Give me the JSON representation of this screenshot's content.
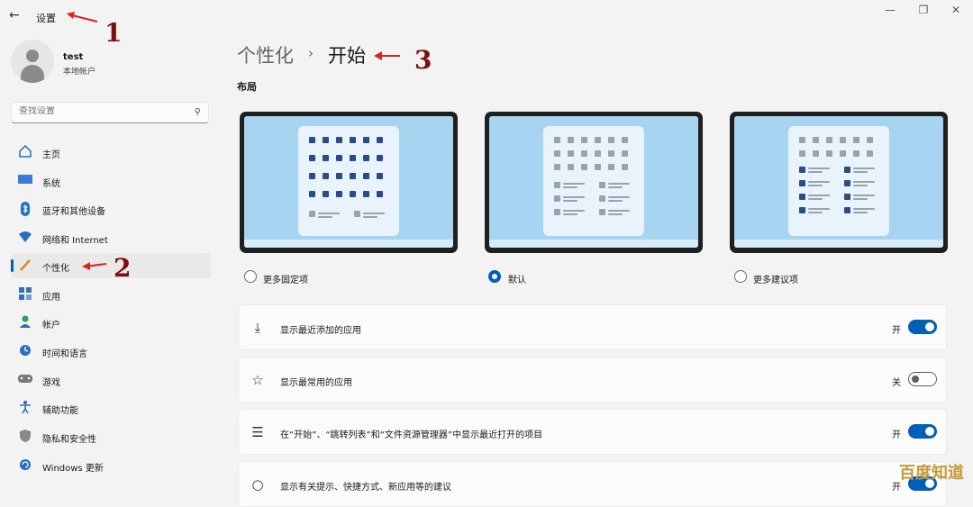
{
  "window": {
    "title": "设置",
    "back_icon": "back-arrow-icon",
    "controls": [
      "minimize-icon",
      "maximize-icon",
      "close-icon"
    ]
  },
  "user": {
    "name": "test",
    "account_type": "本地帐户"
  },
  "search": {
    "placeholder": "查找设置"
  },
  "sidebar": {
    "items": [
      {
        "label": "主页",
        "icon": "home-icon"
      },
      {
        "label": "系统",
        "icon": "system-icon"
      },
      {
        "label": "蓝牙和其他设备",
        "icon": "bluetooth-icon"
      },
      {
        "label": "网络和 Internet",
        "icon": "network-icon"
      },
      {
        "label": "个性化",
        "icon": "personalization-icon",
        "active": true
      },
      {
        "label": "应用",
        "icon": "apps-icon"
      },
      {
        "label": "帐户",
        "icon": "account-icon"
      },
      {
        "label": "时间和语言",
        "icon": "time-language-icon"
      },
      {
        "label": "游戏",
        "icon": "gaming-icon"
      },
      {
        "label": "辅助功能",
        "icon": "accessibility-icon"
      },
      {
        "label": "隐私和安全性",
        "icon": "privacy-shield-icon"
      },
      {
        "label": "Windows 更新",
        "icon": "windows-update-icon"
      }
    ]
  },
  "breadcrumb": {
    "parent": "个性化",
    "separator": "›",
    "current": "开始"
  },
  "layout_section": {
    "title": "布局",
    "options": [
      {
        "label": "更多固定项",
        "selected": false
      },
      {
        "label": "默认",
        "selected": true
      },
      {
        "label": "更多建议项",
        "selected": false
      }
    ]
  },
  "settings": [
    {
      "icon": "download-icon",
      "label": "显示最近添加的应用",
      "state": "开",
      "on": true
    },
    {
      "icon": "star-icon",
      "label": "显示最常用的应用",
      "state": "关",
      "on": false
    },
    {
      "icon": "list-icon",
      "label": "在“开始”、“跳转列表”和“文件资源管理器”中显示最近打开的项目",
      "state": "开",
      "on": true
    },
    {
      "icon": "lightbulb-icon",
      "label": "显示有关提示、快捷方式、新应用等的建议",
      "state": "开",
      "on": true
    }
  ],
  "annotations": [
    "1",
    "2",
    "3"
  ],
  "watermark": "百度知道",
  "colors": {
    "accent": "#005fb8",
    "annotation": "#7a1010"
  }
}
